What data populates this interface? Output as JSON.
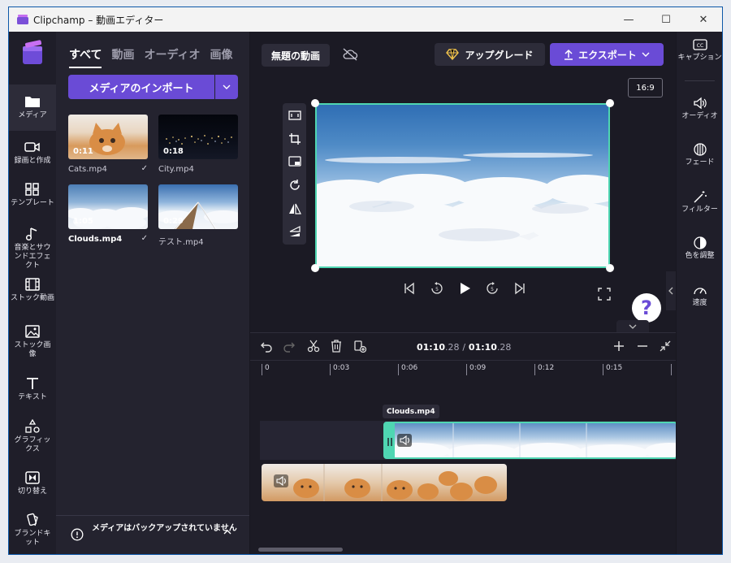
{
  "window": {
    "title": "Clipchamp – 動画エディター"
  },
  "titlebar": {
    "minimize": "—",
    "maximize": "☐",
    "close": "✕"
  },
  "left_rail": {
    "items": [
      {
        "label": "メディア",
        "icon": "folder-icon",
        "active": true
      },
      {
        "label": "録画と作成",
        "icon": "camera-icon"
      },
      {
        "label": "テンプレート",
        "icon": "template-icon"
      },
      {
        "label": "音楽とサウンドエフェクト",
        "icon": "music-icon"
      },
      {
        "label": "ストック動画",
        "icon": "film-icon"
      },
      {
        "label": "ストック画像",
        "icon": "image-icon"
      },
      {
        "label": "テキスト",
        "icon": "text-icon"
      },
      {
        "label": "グラフィックス",
        "icon": "shapes-icon"
      },
      {
        "label": "切り替え",
        "icon": "transition-icon"
      },
      {
        "label": "ブランドキット",
        "icon": "brand-icon"
      }
    ]
  },
  "media_panel": {
    "tabs": [
      "すべて",
      "動画",
      "オーディオ",
      "画像"
    ],
    "import_label": "メディアのインポート",
    "items": [
      {
        "name": "Cats.mp4",
        "duration": "0:11",
        "checked": true
      },
      {
        "name": "City.mp4",
        "duration": "0:18",
        "checked": false
      },
      {
        "name": "Clouds.mp4",
        "duration": "1:05",
        "checked": true
      },
      {
        "name": "テスト.mp4",
        "duration": "0:29",
        "checked": false
      }
    ],
    "backup_message": "メディアはバックアップされていません"
  },
  "header": {
    "project_name": "無題の動画",
    "upgrade_label": "アップグレード",
    "export_label": "エクスポート",
    "aspect_ratio": "16:9"
  },
  "player": {
    "help_label": "?"
  },
  "timeline": {
    "current_time": "01:10",
    "current_frames": ".28",
    "separator": "/",
    "total_time": "01:10",
    "total_frames": ".28",
    "ruler_ticks": [
      "0",
      "0:03",
      "0:06",
      "0:09",
      "0:12",
      "0:15"
    ],
    "selected_clip_label": "Clouds.mp4"
  },
  "right_rail": {
    "items": [
      {
        "label": "キャプション",
        "icon": "caption-icon"
      },
      {
        "label": "オーディオ",
        "icon": "speaker-icon"
      },
      {
        "label": "フェード",
        "icon": "fade-icon"
      },
      {
        "label": "フィルター",
        "icon": "wand-icon"
      },
      {
        "label": "色を調整",
        "icon": "contrast-icon"
      },
      {
        "label": "速度",
        "icon": "speedometer-icon"
      }
    ]
  },
  "colors": {
    "accent": "#6a4bd6",
    "selection": "#4fd6b2",
    "background": "#1b1a24"
  }
}
